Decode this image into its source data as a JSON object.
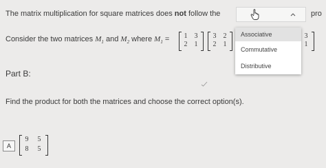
{
  "question": {
    "intro_text": "The matrix multiplication for square matrices does",
    "intro_bold": "not",
    "intro_tail": "follow the",
    "truncated_right": "pro",
    "consider_text": "Consider the two matrices",
    "m1_sym": "M",
    "m1_sub": "1",
    "and_text": "and",
    "m2_sym": "M",
    "m2_sub": "2",
    "where_text": "where",
    "m1_lhs_sym": "M",
    "m1_lhs_sub": "1",
    "eq": "=",
    "matrix_a": [
      [
        "1",
        "3"
      ],
      [
        "2",
        "1"
      ]
    ],
    "matrix_b": [
      [
        "3",
        "2"
      ],
      [
        "2",
        "1"
      ]
    ],
    "matrix_right": [
      [
        "3"
      ],
      [
        "1"
      ]
    ],
    "part_label": "Part B:",
    "instruction": "Find the product for both the matrices and choose the correct option(s).",
    "answer_label": "A",
    "answer_matrix": [
      [
        "9",
        "5"
      ],
      [
        "8",
        "5"
      ]
    ]
  },
  "dropdown": {
    "options": [
      "Associative",
      "Commutative",
      "Distributive"
    ],
    "selected_index": 0,
    "icon_hand": "hand-pointer-icon",
    "icon_chevron": "chevron-up-icon"
  },
  "colors": {
    "background": "#ecebea",
    "text": "#3a3a3a",
    "option_highlight": "#e2e2e2"
  }
}
